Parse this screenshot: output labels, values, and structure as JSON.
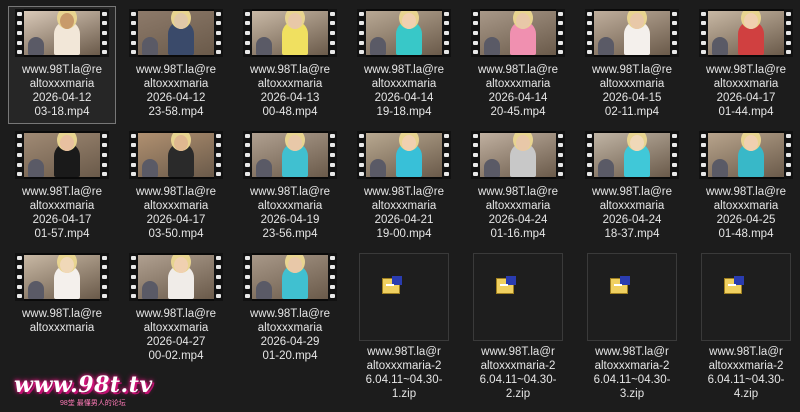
{
  "files": [
    {
      "name": "www.98T.la@realtoxxxmaria 2026-04-12 03-18.mp4",
      "lines": [
        "www.98T.la@re",
        "altoxxxmaria",
        "2026-04-12",
        "03-18.mp4"
      ],
      "type": "video",
      "selected": true,
      "colors": [
        "#d9c9b8",
        "#f2e7d8",
        "#c89a6a"
      ]
    },
    {
      "name": "www.98T.la@realtoxxxmaria 2026-04-12 23-58.mp4",
      "lines": [
        "www.98T.la@re",
        "altoxxxmaria",
        "2026-04-12",
        "23-58.mp4"
      ],
      "type": "video",
      "colors": [
        "#8d7a6a",
        "#3a4a6a",
        "#e0c8a8"
      ]
    },
    {
      "name": "www.98T.la@realtoxxxmaria 2026-04-13 00-48.mp4",
      "lines": [
        "www.98T.la@re",
        "altoxxxmaria",
        "2026-04-13",
        "00-48.mp4"
      ],
      "type": "video",
      "colors": [
        "#c9b9a6",
        "#f0e060",
        "#e8c8a8"
      ]
    },
    {
      "name": "www.98T.la@realtoxxxmaria 2026-04-14 19-18.mp4",
      "lines": [
        "www.98T.la@re",
        "altoxxxmaria",
        "2026-04-14",
        "19-18.mp4"
      ],
      "type": "video",
      "colors": [
        "#b8a894",
        "#38c8c8",
        "#f0d0b0"
      ]
    },
    {
      "name": "www.98T.la@realtoxxxmaria 2026-04-14 20-45.mp4",
      "lines": [
        "www.98T.la@re",
        "altoxxxmaria",
        "2026-04-14",
        "20-45.mp4"
      ],
      "type": "video",
      "colors": [
        "#a89888",
        "#f090b0",
        "#e8c8a8"
      ]
    },
    {
      "name": "www.98T.la@realtoxxxmaria 2026-04-15 02-11.mp4",
      "lines": [
        "www.98T.la@re",
        "altoxxxmaria",
        "2026-04-15",
        "02-11.mp4"
      ],
      "type": "video",
      "colors": [
        "#bfae9c",
        "#f4f0ec",
        "#e8c8a8"
      ]
    },
    {
      "name": "www.98T.la@realtoxxxmaria 2026-04-17 01-44.mp4",
      "lines": [
        "www.98T.la@re",
        "altoxxxmaria",
        "2026-04-17",
        "01-44.mp4"
      ],
      "type": "video",
      "colors": [
        "#c8b8a4",
        "#d04040",
        "#f0d0b0"
      ]
    },
    {
      "name": "www.98T.la@realtoxxxmaria 2026-04-17 01-57.mp4",
      "lines": [
        "www.98T.la@re",
        "altoxxxmaria",
        "2026-04-17",
        "01-57.mp4"
      ],
      "type": "video",
      "colors": [
        "#a08a74",
        "#1a1a1a",
        "#e8c0a0"
      ]
    },
    {
      "name": "www.98T.la@realtoxxxmaria 2026-04-17 03-50.mp4",
      "lines": [
        "www.98T.la@re",
        "altoxxxmaria",
        "2026-04-17",
        "03-50.mp4"
      ],
      "type": "video",
      "colors": [
        "#b09070",
        "#2a2a2a",
        "#e0b890"
      ]
    },
    {
      "name": "www.98T.la@realtoxxxmaria 2026-04-19 23-56.mp4",
      "lines": [
        "www.98T.la@re",
        "altoxxxmaria",
        "2026-04-19",
        "23-56.mp4"
      ],
      "type": "video",
      "colors": [
        "#b0a090",
        "#40c0d0",
        "#e8c8a8"
      ]
    },
    {
      "name": "www.98T.la@realtoxxxmaria 2026-04-21 19-00.mp4",
      "lines": [
        "www.98T.la@re",
        "altoxxxmaria",
        "2026-04-21",
        "19-00.mp4"
      ],
      "type": "video",
      "colors": [
        "#b8a890",
        "#38c0d8",
        "#f0d0b0"
      ]
    },
    {
      "name": "www.98T.la@realtoxxxmaria 2026-04-24 01-16.mp4",
      "lines": [
        "www.98T.la@re",
        "altoxxxmaria",
        "2026-04-24",
        "01-16.mp4"
      ],
      "type": "video",
      "colors": [
        "#c0b0a0",
        "#c8c8c8",
        "#e8c8a8"
      ]
    },
    {
      "name": "www.98T.la@realtoxxxmaria 2026-04-24 18-37.mp4",
      "lines": [
        "www.98T.la@re",
        "altoxxxmaria",
        "2026-04-24",
        "18-37.mp4"
      ],
      "type": "video",
      "colors": [
        "#c0b4a4",
        "#40c8d8",
        "#f0d8b8"
      ]
    },
    {
      "name": "www.98T.la@realtoxxxmaria 2026-04-25 01-48.mp4",
      "lines": [
        "www.98T.la@re",
        "altoxxxmaria",
        "2026-04-25",
        "01-48.mp4"
      ],
      "type": "video",
      "colors": [
        "#b8a48c",
        "#38b8c8",
        "#f0d0b0"
      ]
    },
    {
      "name": "blank-1",
      "type": "empty"
    },
    {
      "name": "blank-2",
      "type": "empty"
    },
    {
      "name": "blank-3",
      "type": "empty"
    },
    {
      "name": "blank-4",
      "type": "empty"
    },
    {
      "name": "blank-5",
      "type": "empty"
    },
    {
      "name": "blank-6",
      "type": "empty"
    },
    {
      "name": "blank-7",
      "type": "empty"
    }
  ],
  "row3": [
    {
      "name": "www.98T.la@realtoxxxmaria 2026-04-27 ...mp4",
      "lines": [
        "www.98T.la@re",
        "altoxxxmaria",
        "",
        ""
      ],
      "type": "video",
      "colors": [
        "#c8b8a4",
        "#f4f0ec",
        "#f0d8b8"
      ]
    },
    {
      "name": "www.98T.la@realtoxxxmaria 2026-04-27 00-02.mp4",
      "lines": [
        "www.98T.la@re",
        "altoxxxmaria",
        "2026-04-27",
        "00-02.mp4"
      ],
      "type": "video",
      "colors": [
        "#b0a090",
        "#f0ece8",
        "#f0d0b0"
      ]
    },
    {
      "name": "www.98T.la@realtoxxxmaria 2026-04-29 01-20.mp4",
      "lines": [
        "www.98T.la@re",
        "altoxxxmaria",
        "2026-04-29",
        "01-20.mp4"
      ],
      "type": "video",
      "colors": [
        "#a89888",
        "#40c0d0",
        "#e8c8a8"
      ]
    },
    {
      "name": "www.98T.la@realtoxxxmaria-26.04.11~04.30-1.zip",
      "lines": [
        "www.98T.la@r",
        "altoxxxmaria-2",
        "6.04.11~04.30-",
        "1.zip"
      ],
      "type": "zip"
    },
    {
      "name": "www.98T.la@realtoxxxmaria-26.04.11~04.30-2.zip",
      "lines": [
        "www.98T.la@r",
        "altoxxxmaria-2",
        "6.04.11~04.30-",
        "2.zip"
      ],
      "type": "zip"
    },
    {
      "name": "www.98T.la@realtoxxxmaria-26.04.11~04.30-3.zip",
      "lines": [
        "www.98T.la@r",
        "altoxxxmaria-2",
        "6.04.11~04.30-",
        "3.zip"
      ],
      "type": "zip"
    },
    {
      "name": "www.98T.la@realtoxxxmaria-26.04.11~04.30-4.zip",
      "lines": [
        "www.98T.la@r",
        "altoxxxmaria-2",
        "6.04.11~04.30-",
        "4.zip"
      ],
      "type": "zip"
    }
  ],
  "watermark": {
    "text": "www.98t.tv",
    "sub": "98堂 最懂男人的论坛"
  }
}
